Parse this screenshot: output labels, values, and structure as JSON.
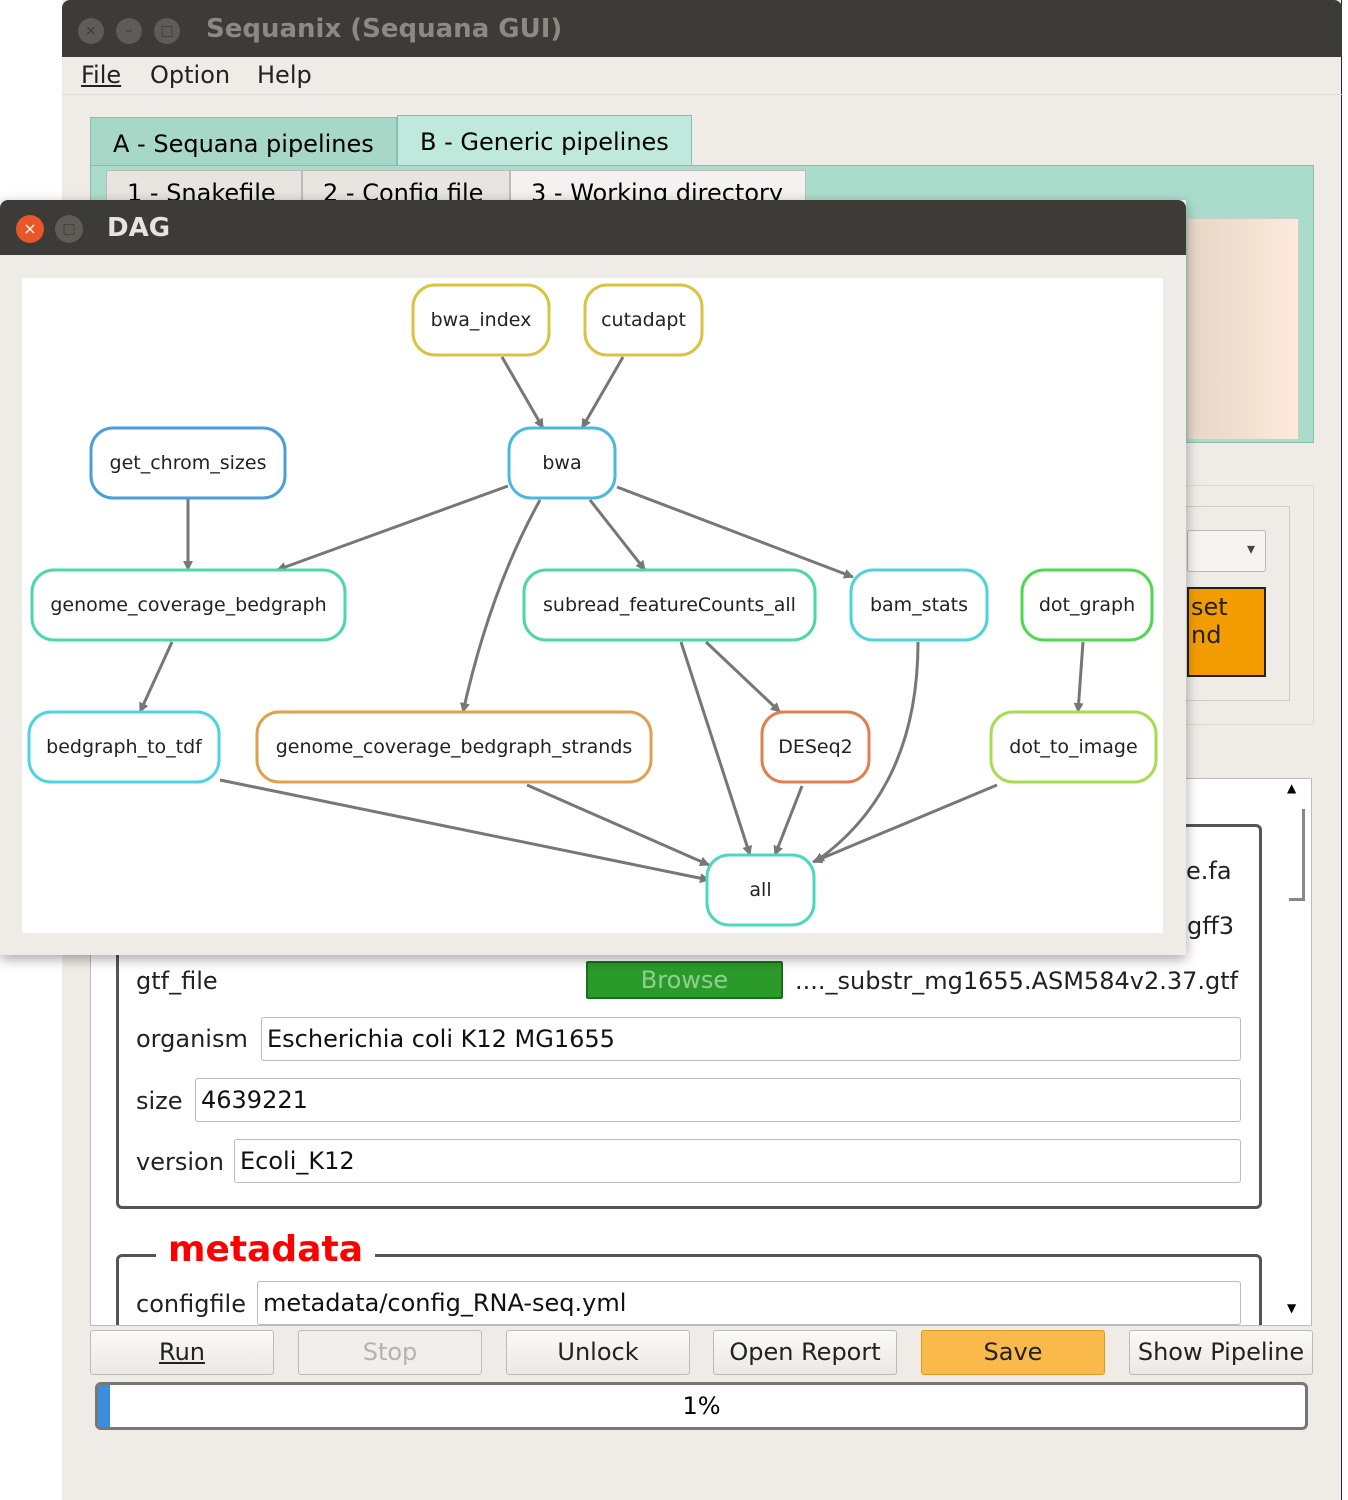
{
  "main_window": {
    "title": "Sequanix (Sequana GUI)",
    "close": "×",
    "minimize": "–",
    "maximize": "□"
  },
  "menu": [
    "File",
    "Option",
    "Help"
  ],
  "tabs": [
    {
      "label": "A - Sequana pipelines",
      "active": false
    },
    {
      "label": "B - Generic pipelines",
      "active": true
    }
  ],
  "subtabs": [
    "1 - Snakefile",
    "2 - Config file",
    "3 - Working directory"
  ],
  "side_panel": {
    "dropdown_arrow": "▾",
    "orange_button_text": "set\nnd"
  },
  "config": {
    "partial_rows": [
      "e.fa",
      "gff3"
    ],
    "gtf_file": {
      "label": "gtf_file",
      "button": "Browse",
      "value": "...._substr_mg1655.ASM584v2.37.gtf"
    },
    "organism": {
      "label": "organism",
      "value": "Escherichia coli K12 MG1655"
    },
    "size": {
      "label": "size",
      "value": "4639221"
    },
    "version": {
      "label": "version",
      "value": "Ecoli_K12"
    },
    "metadata": {
      "title": "metadata",
      "configfile_label": "configfile",
      "configfile_value": "metadata/config_RNA-seq.yml"
    },
    "scroll_up": "▲",
    "scroll_down": "▼"
  },
  "buttons": [
    {
      "label": "Run",
      "enabled": true
    },
    {
      "label": "Stop",
      "enabled": false
    },
    {
      "label": "Unlock",
      "enabled": true
    },
    {
      "label": "Open Report",
      "enabled": true
    },
    {
      "label": "Save",
      "enabled": true,
      "color": "#f9b94b"
    },
    {
      "label": "Show Pipeline",
      "enabled": true
    }
  ],
  "progress": {
    "value": 1,
    "label": "1%"
  },
  "dag_window": {
    "title": "DAG",
    "close": "×",
    "maximize": "□",
    "nodes": [
      {
        "id": "bwa_index",
        "color": "#d8c440"
      },
      {
        "id": "cutadapt",
        "color": "#d8c440"
      },
      {
        "id": "get_chrom_sizes",
        "color": "#4a9fd8"
      },
      {
        "id": "bwa",
        "color": "#4cb8e0"
      },
      {
        "id": "genome_coverage_bedgraph",
        "color": "#4cd8a8"
      },
      {
        "id": "subread_featureCounts_all",
        "color": "#4cd8a0"
      },
      {
        "id": "bam_stats",
        "color": "#4cd4d8"
      },
      {
        "id": "dot_graph",
        "color": "#50d850"
      },
      {
        "id": "bedgraph_to_tdf",
        "color": "#4cd4e0"
      },
      {
        "id": "genome_coverage_bedgraph_strands",
        "color": "#e0a050"
      },
      {
        "id": "DESeq2",
        "color": "#e08050"
      },
      {
        "id": "dot_to_image",
        "color": "#a8dc50"
      },
      {
        "id": "all",
        "color": "#4cd8c0"
      }
    ],
    "edges": [
      [
        "bwa_index",
        "bwa"
      ],
      [
        "cutadapt",
        "bwa"
      ],
      [
        "get_chrom_sizes",
        "genome_coverage_bedgraph"
      ],
      [
        "bwa",
        "genome_coverage_bedgraph"
      ],
      [
        "bwa",
        "genome_coverage_bedgraph_strands"
      ],
      [
        "bwa",
        "subread_featureCounts_all"
      ],
      [
        "bwa",
        "bam_stats"
      ],
      [
        "genome_coverage_bedgraph",
        "bedgraph_to_tdf"
      ],
      [
        "subread_featureCounts_all",
        "DESeq2"
      ],
      [
        "subread_featureCounts_all",
        "all"
      ],
      [
        "bam_stats",
        "all"
      ],
      [
        "dot_graph",
        "dot_to_image"
      ],
      [
        "DESeq2",
        "all"
      ],
      [
        "dot_to_image",
        "all"
      ],
      [
        "bedgraph_to_tdf",
        "all"
      ],
      [
        "genome_coverage_bedgraph_strands",
        "all"
      ]
    ]
  }
}
